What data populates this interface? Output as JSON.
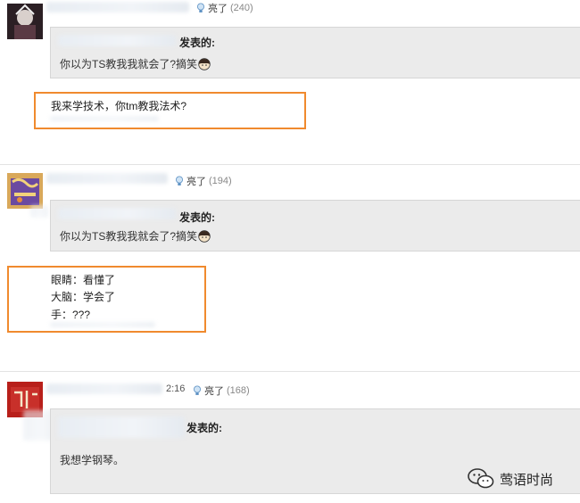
{
  "comments": [
    {
      "like_label": "亮了",
      "like_count": "(240)",
      "quote_author_suffix": "发表的:",
      "quote_text": "你以为TS教我我就会了?",
      "quote_tail": "摘笑",
      "reply_lines": [
        "我来学技术，你tm教我法术?"
      ]
    },
    {
      "like_label": "亮了",
      "like_count": "(194)",
      "quote_author_suffix": "发表的:",
      "quote_text": "你以为TS教我我就会了?",
      "quote_tail": "摘笑",
      "reply_lines": [
        "眼睛：看懂了",
        "大脑：学会了",
        "手：???"
      ]
    },
    {
      "time": "2:16",
      "like_label": "亮了",
      "like_count": "(168)",
      "quote_author_suffix": "发表的:",
      "quote_text": "我想学钢琴。",
      "reply_lines": []
    }
  ],
  "watermark": {
    "text": "莺语时尚",
    "icon": "wechat-icon"
  },
  "colors": {
    "highlight": "#f08a2e",
    "quote_bg": "#ebebeb"
  }
}
